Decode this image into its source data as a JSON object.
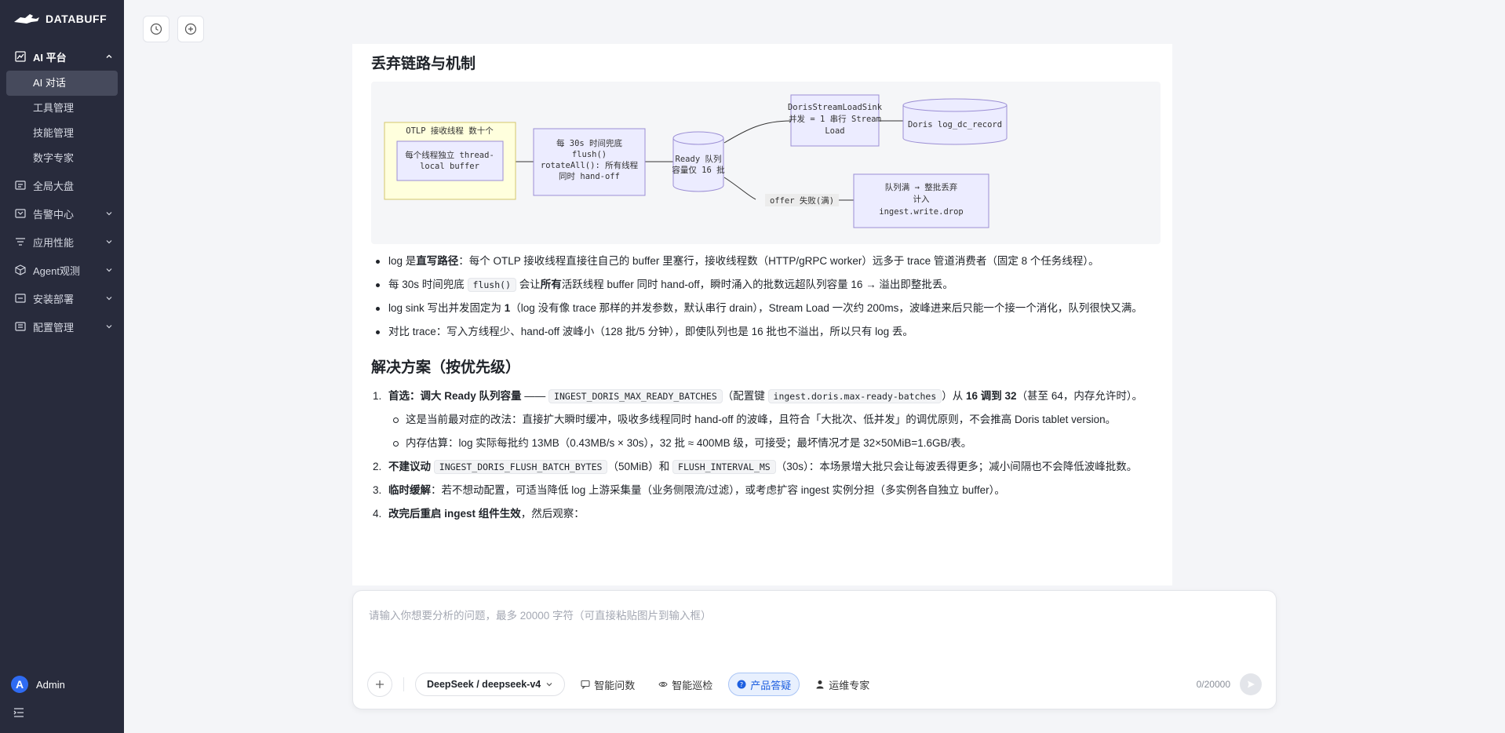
{
  "brand": "DATABUFF",
  "sidebar": {
    "groups": [
      {
        "label": "AI 平台",
        "icon": "chart-edit-icon"
      },
      {
        "label": "全局大盘",
        "icon": "dashboard-icon"
      },
      {
        "label": "告警中心",
        "icon": "alarm-icon"
      },
      {
        "label": "应用性能",
        "icon": "filter-icon"
      },
      {
        "label": "Agent观测",
        "icon": "cube-icon"
      },
      {
        "label": "安装部署",
        "icon": "install-icon"
      },
      {
        "label": "配置管理",
        "icon": "config-icon"
      }
    ],
    "ai_items": [
      "AI 对话",
      "工具管理",
      "技能管理",
      "数字专家"
    ],
    "user": {
      "initial": "A",
      "name": "Admin"
    }
  },
  "content": {
    "section1_title": "丢弃链路与机制",
    "diagram": {
      "box1_title": "OTLP 接收线程 数十个",
      "box1_inner_l1": "每个线程独立 thread-",
      "box1_inner_l2": "local buffer",
      "box2_l1": "每 30s 时间兜底",
      "box2_l2": "flush()",
      "box2_l3": "rotateAll(): 所有线程",
      "box2_l4": "同时 hand-off",
      "cyl1_l1": "Ready 队列",
      "cyl1_l2": "容量仅 16 批",
      "box3_l1": "DorisStreamLoadSink",
      "box3_l2": "并发 = 1 串行 Stream",
      "box3_l3": "Load",
      "cyl2": "Doris log_dc_record",
      "edge_label": "offer 失败(满)",
      "box4_l1": "队列满 → 整批丢弃",
      "box4_l2": "计入",
      "box4_l3": "ingest.write.drop"
    },
    "bullets": {
      "b1_a": "log 是",
      "b1_b": "直写路径",
      "b1_c": "：每个 OTLP 接收线程直接往自己的 buffer 里塞行，接收线程数（HTTP/gRPC worker）远多于 trace 管道消费者（固定 8 个任务线程）。",
      "b2_a": "每 30s 时间兜底 ",
      "b2_code": "flush()",
      "b2_b": " 会让",
      "b2_c": "所有",
      "b2_d": "活跃线程 buffer 同时 hand-off，瞬时涌入的批数远超队列容量 16 → 溢出即整批丢。",
      "b3_a": "log sink 写出并发固定为 ",
      "b3_b": "1",
      "b3_c": "（log 没有像 trace 那样的并发参数，默认串行 drain），Stream Load 一次约 200ms，波峰进来后只能一个接一个消化，队列很快又满。",
      "b4": "对比 trace：写入方线程少、hand-off 波峰小（128 批/5 分钟），即使队列也是 16 批也不溢出，所以只有 log 丢。"
    },
    "section2_title": "解决方案（按优先级）",
    "steps": {
      "s1_num": "1.",
      "s1_a": "首选：调大 Ready 队列容量",
      "s1_b": " —— ",
      "s1_code1": "INGEST_DORIS_MAX_READY_BATCHES",
      "s1_c": "（配置键 ",
      "s1_code2": "ingest.doris.max-ready-batches",
      "s1_d": "）从 ",
      "s1_e": "16 调到 32",
      "s1_f": "（甚至 64，内存允许时）。",
      "s1_sub1": "这是当前最对症的改法：直接扩大瞬时缓冲，吸收多线程同时 hand-off 的波峰，且符合「大批次、低并发」的调优原则，不会推高 Doris tablet version。",
      "s1_sub2": "内存估算：log 实际每批约 13MB（0.43MB/s × 30s），32 批 ≈ 400MB 级，可接受；最坏情况才是 32×50MiB=1.6GB/表。",
      "s2_num": "2.",
      "s2_a": "不建议动",
      "s2_b": " ",
      "s2_code1": "INGEST_DORIS_FLUSH_BATCH_BYTES",
      "s2_c": "（50MiB）和 ",
      "s2_code2": "FLUSH_INTERVAL_MS",
      "s2_d": "（30s）：本场景增大批只会让每波丢得更多；减小间隔也不会降低波峰批数。",
      "s3_num": "3.",
      "s3_a": "临时缓解",
      "s3_b": "：若不想动配置，可适当降低 log 上游采集量（业务侧限流/过滤），或考虑扩容 ingest 实例分担（多实例各自独立 buffer）。",
      "s4_num": "4.",
      "s4_a": "改完后重启 ingest 组件生效",
      "s4_b": "，然后观察："
    }
  },
  "input": {
    "placeholder": "请输入你想要分析的问题，最多 20000 字符（可直接粘贴图片到输入框）",
    "model": "DeepSeek / deepseek-v4",
    "chips": [
      "智能问数",
      "智能巡检",
      "产品答疑",
      "运维专家"
    ],
    "counter": "0/20000"
  },
  "colors": {
    "sidebar_bg": "#282b3c",
    "accent": "#2f6bf2",
    "active_chip": "#1d5fe0"
  }
}
